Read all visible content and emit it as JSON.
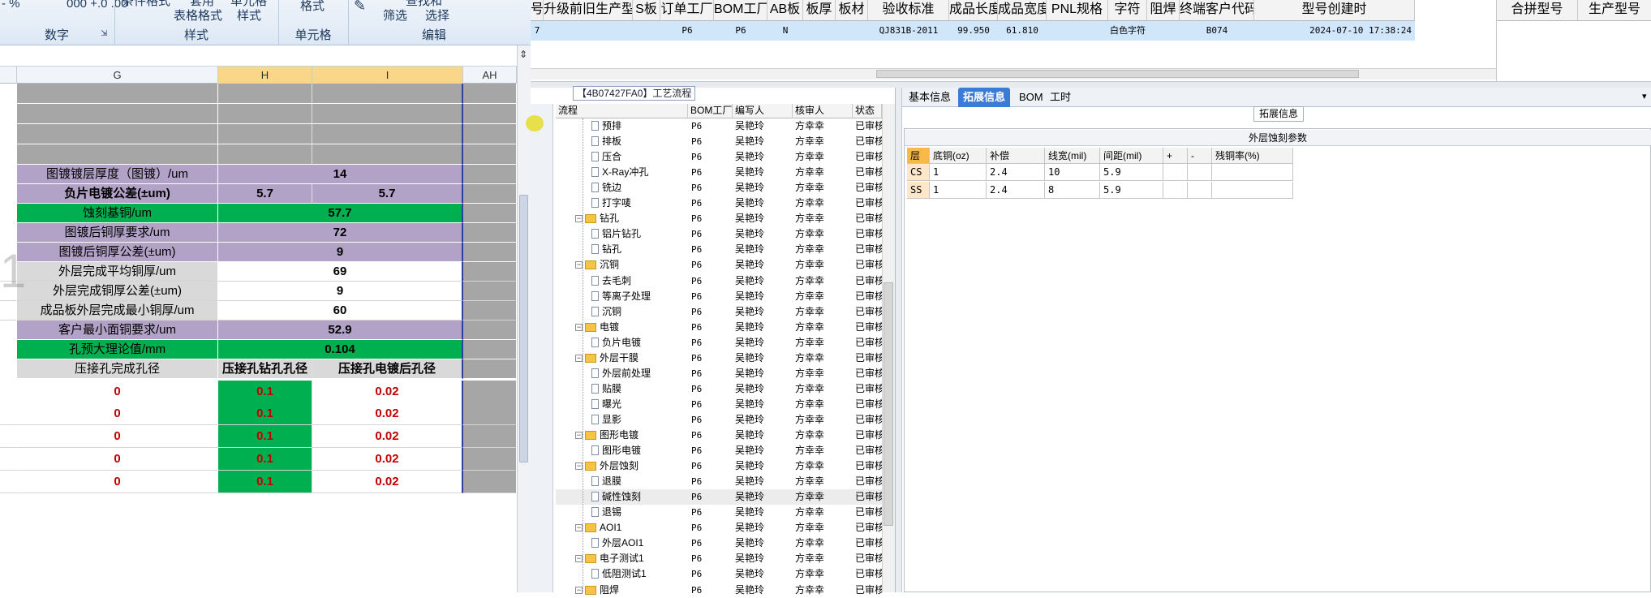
{
  "ribbon": {
    "top_texts": [
      "- %",
      "000 +.0 .00",
      "条件格式",
      "套用",
      "单元格",
      "格式",
      "查找和",
      "表格格式",
      "样式",
      "筛选",
      "选择"
    ],
    "groups": [
      "数字",
      "样式",
      "单元格",
      "编辑"
    ]
  },
  "excel": {
    "col_headers": [
      "G",
      "H",
      "I",
      "AH"
    ],
    "rows": [
      {
        "g": "",
        "h": "",
        "i": "",
        "style": "gray"
      },
      {
        "g": "",
        "h": "",
        "i": "",
        "style": "gray"
      },
      {
        "g": "",
        "h": "",
        "i": "",
        "style": "gray"
      },
      {
        "g": "",
        "h": "",
        "i": "",
        "style": "gray"
      },
      {
        "g": "图镀镀层厚度（图镀）/um",
        "h": "14",
        "i": "",
        "style": "purple",
        "merged": true
      },
      {
        "g": "负片电镀公差(±um)",
        "h": "5.7",
        "i": "5.7",
        "style": "purple",
        "boldlabel": true
      },
      {
        "g": "蚀刻基铜/um",
        "h": "57.7",
        "i": "",
        "style": "green",
        "merged": true
      },
      {
        "g": "图镀后铜厚要求/um",
        "h": "72",
        "i": "",
        "style": "purple",
        "merged": true
      },
      {
        "g": "图镀后铜厚公差(±um)",
        "h": "9",
        "i": "",
        "style": "purple",
        "merged": true
      },
      {
        "g": "外层完成平均铜厚/um",
        "h": "69",
        "i": "",
        "style": "white",
        "merged": true
      },
      {
        "g": "外层完成铜厚公差(±um)",
        "h": "9",
        "i": "",
        "style": "white",
        "merged": true
      },
      {
        "g": "成品板外层完成最小铜厚/um",
        "h": "60",
        "i": "",
        "style": "white",
        "merged": true
      },
      {
        "g": "客户最小面铜要求/um",
        "h": "52.9",
        "i": "",
        "style": "purple",
        "merged": true
      },
      {
        "g": "孔预大理论值/mm",
        "h": "0.104",
        "i": "",
        "style": "green",
        "merged": true
      },
      {
        "g": "压接孔完成孔径",
        "h": "压接孔钻孔孔径",
        "i": "压接孔电镀后孔径",
        "style": "header"
      },
      {
        "g": "0",
        "h": "0.1",
        "i": "0.02",
        "style": "data"
      },
      {
        "g": "0",
        "h": "0.1",
        "i": "0.02",
        "style": "data"
      },
      {
        "g": "0",
        "h": "0.1",
        "i": "0.02",
        "style": "data"
      },
      {
        "g": "0",
        "h": "0.1",
        "i": "0.02",
        "style": "data"
      },
      {
        "g": "0",
        "h": "0.1",
        "i": "0.02",
        "style": "data"
      }
    ]
  },
  "topgrid": {
    "headers": [
      "号",
      "升级前旧生产型号",
      "S板",
      "订单工厂",
      "BOM工厂",
      "AB板",
      "板厚",
      "板材",
      "验收标准",
      "成品长度",
      "成品宽度",
      "PNL规格",
      "字符",
      "阻焊",
      "终端客户代码",
      "型号创建时"
    ],
    "row": [
      "7",
      "",
      "",
      "P6",
      "P6",
      "N",
      "",
      "",
      "QJ831B-2011",
      "99.950",
      "61.810",
      "",
      "白色字符",
      "",
      "B074",
      "2024-07-10 17:38:24"
    ],
    "far_headers": [
      "合拼型号",
      "生产型号"
    ]
  },
  "process": {
    "title": "【4B07427FA0】工艺流程",
    "headers": [
      "流程",
      "BOM工厂",
      "编写人",
      "核审人",
      "状态"
    ],
    "rows": [
      {
        "name": "预排",
        "level": 2,
        "bom": "P6",
        "author": "吴艳玲",
        "reviewer": "方幸幸",
        "status": "已审核"
      },
      {
        "name": "排板",
        "level": 2,
        "bom": "P6",
        "author": "吴艳玲",
        "reviewer": "方幸幸",
        "status": "已审核"
      },
      {
        "name": "压合",
        "level": 2,
        "bom": "P6",
        "author": "吴艳玲",
        "reviewer": "方幸幸",
        "status": "已审核"
      },
      {
        "name": "X-Ray冲孔",
        "level": 2,
        "bom": "P6",
        "author": "吴艳玲",
        "reviewer": "方幸幸",
        "status": "已审核"
      },
      {
        "name": "铣边",
        "level": 2,
        "bom": "P6",
        "author": "吴艳玲",
        "reviewer": "方幸幸",
        "status": "已审核"
      },
      {
        "name": "打字唛",
        "level": 2,
        "bom": "P6",
        "author": "吴艳玲",
        "reviewer": "方幸幸",
        "status": "已审核"
      },
      {
        "name": "钻孔",
        "level": 1,
        "bom": "P6",
        "author": "吴艳玲",
        "reviewer": "方幸幸",
        "status": "已审核"
      },
      {
        "name": "铝片钻孔",
        "level": 2,
        "bom": "P6",
        "author": "吴艳玲",
        "reviewer": "方幸幸",
        "status": "已审核"
      },
      {
        "name": "钻孔",
        "level": 2,
        "bom": "P6",
        "author": "吴艳玲",
        "reviewer": "方幸幸",
        "status": "已审核"
      },
      {
        "name": "沉铜",
        "level": 1,
        "bom": "P6",
        "author": "吴艳玲",
        "reviewer": "方幸幸",
        "status": "已审核"
      },
      {
        "name": "去毛刺",
        "level": 2,
        "bom": "P6",
        "author": "吴艳玲",
        "reviewer": "方幸幸",
        "status": "已审核"
      },
      {
        "name": "等离子处理",
        "level": 2,
        "bom": "P6",
        "author": "吴艳玲",
        "reviewer": "方幸幸",
        "status": "已审核"
      },
      {
        "name": "沉铜",
        "level": 2,
        "bom": "P6",
        "author": "吴艳玲",
        "reviewer": "方幸幸",
        "status": "已审核"
      },
      {
        "name": "电镀",
        "level": 1,
        "bom": "P6",
        "author": "吴艳玲",
        "reviewer": "方幸幸",
        "status": "已审核"
      },
      {
        "name": "负片电镀",
        "level": 2,
        "bom": "P6",
        "author": "吴艳玲",
        "reviewer": "方幸幸",
        "status": "已审核"
      },
      {
        "name": "外层干膜",
        "level": 1,
        "bom": "P6",
        "author": "吴艳玲",
        "reviewer": "方幸幸",
        "status": "已审核"
      },
      {
        "name": "外层前处理",
        "level": 2,
        "bom": "P6",
        "author": "吴艳玲",
        "reviewer": "方幸幸",
        "status": "已审核"
      },
      {
        "name": "贴膜",
        "level": 2,
        "bom": "P6",
        "author": "吴艳玲",
        "reviewer": "方幸幸",
        "status": "已审核"
      },
      {
        "name": "曝光",
        "level": 2,
        "bom": "P6",
        "author": "吴艳玲",
        "reviewer": "方幸幸",
        "status": "已审核"
      },
      {
        "name": "显影",
        "level": 2,
        "bom": "P6",
        "author": "吴艳玲",
        "reviewer": "方幸幸",
        "status": "已审核"
      },
      {
        "name": "图形电镀",
        "level": 1,
        "bom": "P6",
        "author": "吴艳玲",
        "reviewer": "方幸幸",
        "status": "已审核"
      },
      {
        "name": "图形电镀",
        "level": 2,
        "bom": "P6",
        "author": "吴艳玲",
        "reviewer": "方幸幸",
        "status": "已审核"
      },
      {
        "name": "外层蚀刻",
        "level": 1,
        "bom": "P6",
        "author": "吴艳玲",
        "reviewer": "方幸幸",
        "status": "已审核"
      },
      {
        "name": "退膜",
        "level": 2,
        "bom": "P6",
        "author": "吴艳玲",
        "reviewer": "方幸幸",
        "status": "已审核"
      },
      {
        "name": "碱性蚀刻",
        "level": 2,
        "bom": "P6",
        "author": "吴艳玲",
        "reviewer": "方幸幸",
        "status": "已审核",
        "highlight": true
      },
      {
        "name": "退锡",
        "level": 2,
        "bom": "P6",
        "author": "吴艳玲",
        "reviewer": "方幸幸",
        "status": "已审核"
      },
      {
        "name": "AOI1",
        "level": 1,
        "bom": "P6",
        "author": "吴艳玲",
        "reviewer": "方幸幸",
        "status": "已审核"
      },
      {
        "name": "外层AOI1",
        "level": 2,
        "bom": "P6",
        "author": "吴艳玲",
        "reviewer": "方幸幸",
        "status": "已审核"
      },
      {
        "name": "电子测试1",
        "level": 1,
        "bom": "P6",
        "author": "吴艳玲",
        "reviewer": "方幸幸",
        "status": "已审核"
      },
      {
        "name": "低阻测试1",
        "level": 2,
        "bom": "P6",
        "author": "吴艳玲",
        "reviewer": "方幸幸",
        "status": "已审核"
      },
      {
        "name": "阻焊",
        "level": 1,
        "bom": "P6",
        "author": "吴艳玲",
        "reviewer": "方幸幸",
        "status": "已审核"
      }
    ]
  },
  "detail": {
    "tabs": [
      "基本信息",
      "拓展信息",
      "BOM",
      "工时"
    ],
    "active_tab": "拓展信息",
    "subtab": "拓展信息",
    "caption": "外层蚀刻参数",
    "headers": [
      "层",
      "底铜(oz)",
      "补偿",
      "线宽(mil)",
      "间距(mil)",
      "+",
      "-",
      "残铜率(%)"
    ],
    "rows": [
      [
        "CS",
        "1",
        "2.4",
        "10",
        "5.9",
        "",
        "",
        ""
      ],
      [
        "SS",
        "1",
        "2.4",
        "8",
        "5.9",
        "",
        "",
        ""
      ]
    ]
  },
  "colors": {
    "purple": "#b2a2c7",
    "green": "#00b050",
    "gray": "#a6a6a6",
    "header_gray": "#d9d9d9",
    "tab_blue": "#3a7bd5",
    "row_blue": "#cfe6fb"
  }
}
